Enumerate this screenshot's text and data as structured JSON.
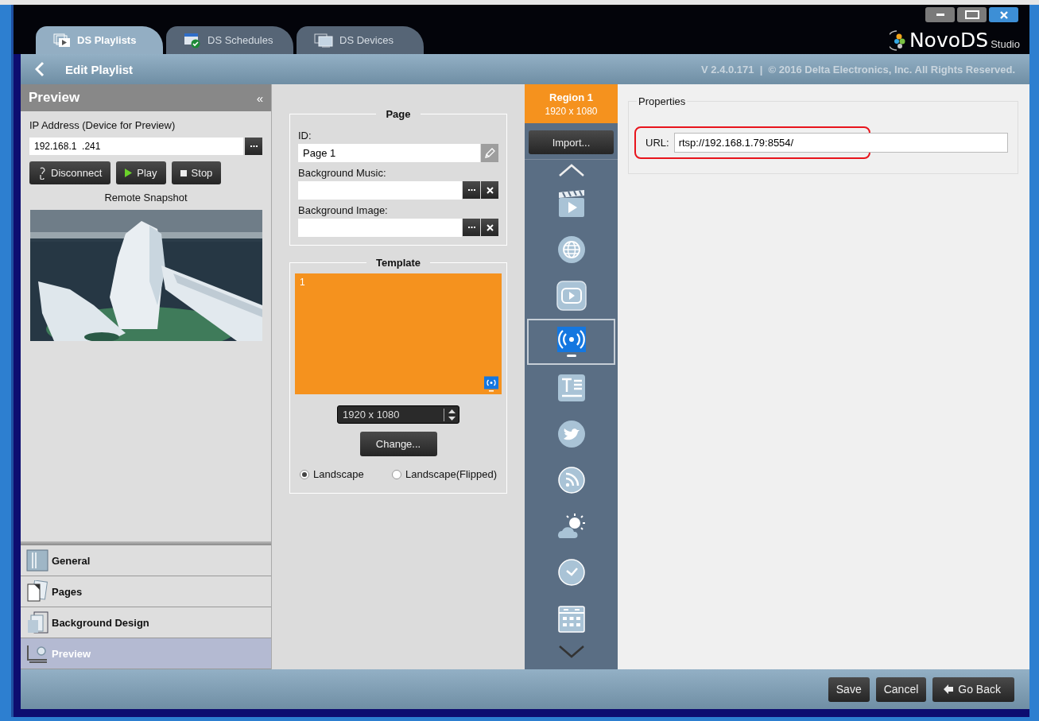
{
  "window": {
    "controls": [
      {
        "kind": "minimize"
      },
      {
        "kind": "maximize"
      },
      {
        "kind": "close"
      }
    ],
    "logo": {
      "name": "NovoDS",
      "suffix": "Studio"
    }
  },
  "tabs": [
    {
      "label": "DS Playlists",
      "kind": "playlists",
      "selected": true
    },
    {
      "label": "DS Schedules",
      "kind": "schedules",
      "selected": false
    },
    {
      "label": "DS Devices",
      "kind": "devices",
      "selected": false
    }
  ],
  "header": {
    "title": "Edit Playlist",
    "version": "V 2.4.0.171  |  © 2016 Delta Electronics, Inc. All Rights Reserved."
  },
  "preview_panel": {
    "title": "Preview",
    "collapse": "«",
    "ip_label": "IP Address (Device for Preview)",
    "ip_value": "192.168.1  .241",
    "buttons": [
      {
        "label": "Disconnect",
        "kind": "disconnect"
      },
      {
        "label": "Play",
        "kind": "play"
      },
      {
        "label": "Stop",
        "kind": "stop"
      }
    ],
    "snapshot_label": "Remote Snapshot"
  },
  "nav": [
    {
      "label": "General",
      "kind": "general",
      "selected": false
    },
    {
      "label": "Pages",
      "kind": "pages",
      "selected": false
    },
    {
      "label": "Background Design",
      "kind": "background",
      "selected": false
    },
    {
      "label": "Preview",
      "kind": "preview",
      "selected": true
    }
  ],
  "page": {
    "title": "Page",
    "fields": [
      {
        "label": "ID:",
        "value": "Page 1",
        "kind": "editable"
      },
      {
        "label": "Background Music:",
        "kind": "file"
      },
      {
        "label": "Background Image:",
        "kind": "file"
      }
    ]
  },
  "template": {
    "title": "Template",
    "region_label": "1",
    "resolution": "1920 x 1080",
    "change_button": "Change...",
    "orientations": [
      {
        "label": "Landscape",
        "selected": true
      },
      {
        "label": "Landscape(Flipped)",
        "selected": false
      }
    ]
  },
  "region": {
    "title": "Region 1",
    "size": "1920 x 1080",
    "import_button": "Import...",
    "media_types": [
      {
        "kind": "video",
        "selected": false
      },
      {
        "kind": "web",
        "selected": false
      },
      {
        "kind": "youtube",
        "selected": false
      },
      {
        "kind": "stream",
        "selected": true
      },
      {
        "kind": "text",
        "selected": false
      },
      {
        "kind": "twitter",
        "selected": false
      },
      {
        "kind": "rss",
        "selected": false
      },
      {
        "kind": "weather",
        "selected": false
      },
      {
        "kind": "clock",
        "selected": false
      },
      {
        "kind": "calendar",
        "selected": false
      }
    ]
  },
  "properties": {
    "title": "Properties",
    "url_label": "URL:",
    "url_value": "rtsp://192.168.1.79:8554/",
    "highlighted": true
  },
  "footer": {
    "buttons": [
      {
        "label": "Save",
        "kind": "save"
      },
      {
        "label": "Cancel",
        "kind": "cancel"
      },
      {
        "label": "Go Back",
        "kind": "back"
      }
    ]
  }
}
